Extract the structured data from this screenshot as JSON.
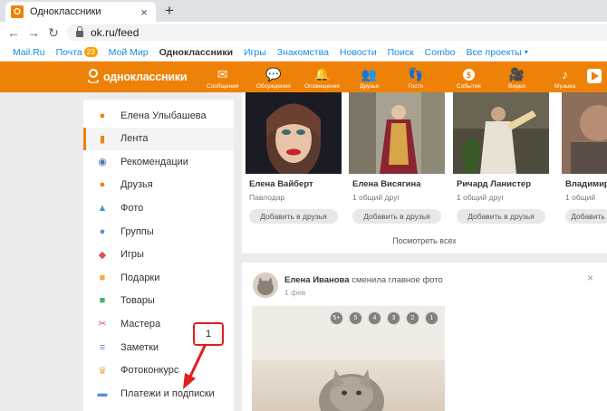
{
  "browser": {
    "tab_title": "Одноклассники",
    "tab_favicon": "О",
    "tab_close": "×",
    "new_tab": "+",
    "back": "←",
    "forward": "→",
    "reload": "↻",
    "url": "ok.ru/feed"
  },
  "portal_bar": {
    "items": [
      {
        "label": "Mail.Ru"
      },
      {
        "label": "Почта",
        "badge": "23"
      },
      {
        "label": "Мой Мир"
      },
      {
        "label": "Одноклассники",
        "active": true
      },
      {
        "label": "Игры"
      },
      {
        "label": "Знакомства"
      },
      {
        "label": "Новости"
      },
      {
        "label": "Поиск"
      },
      {
        "label": "Combo"
      },
      {
        "label": "Все проекты",
        "caret": "▾"
      }
    ]
  },
  "header": {
    "logo_text": "одноклассники",
    "brand_color": "#ee8208",
    "nav": [
      {
        "label": "Сообщения",
        "icon": "envelope-icon",
        "glyph": "✉"
      },
      {
        "label": "Обсуждения",
        "icon": "chat-icon",
        "glyph": "💬"
      },
      {
        "label": "Оповещения",
        "icon": "bell-icon",
        "glyph": "🔔"
      },
      {
        "label": "Друзья",
        "icon": "friends-icon",
        "glyph": "👥"
      },
      {
        "label": "Гости",
        "icon": "footprints-icon",
        "glyph": "👣"
      },
      {
        "label": "События",
        "icon": "coin-icon",
        "glyph": "$"
      },
      {
        "label": "Видео",
        "icon": "video-camera-icon",
        "glyph": "🎥"
      },
      {
        "label": "Музыка",
        "icon": "music-note-icon",
        "glyph": "♪"
      }
    ]
  },
  "left_menu": {
    "items": [
      {
        "label": "Елена Улыбашева",
        "icon": "profile-icon",
        "color": "#ee8208",
        "glyph": "●"
      },
      {
        "label": "Лента",
        "icon": "feed-icon",
        "color": "#ee8208",
        "glyph": "▮",
        "active": true
      },
      {
        "label": "Рекомендации",
        "icon": "compass-icon",
        "color": "#4a76a8",
        "glyph": "◉"
      },
      {
        "label": "Друзья",
        "icon": "friends-icon",
        "color": "#ee8208",
        "glyph": "●"
      },
      {
        "label": "Фото",
        "icon": "photo-icon",
        "color": "#3f9ad8",
        "glyph": "▲"
      },
      {
        "label": "Группы",
        "icon": "groups-icon",
        "color": "#5a8dd6",
        "glyph": "●"
      },
      {
        "label": "Игры",
        "icon": "gamepad-icon",
        "color": "#d9534f",
        "glyph": "◆"
      },
      {
        "label": "Подарки",
        "icon": "gift-icon",
        "color": "#f0ad4e",
        "glyph": "■"
      },
      {
        "label": "Товары",
        "icon": "shopping-bag-icon",
        "color": "#3fb56b",
        "glyph": "■"
      },
      {
        "label": "Мастера",
        "icon": "tools-icon",
        "color": "#d9534f",
        "glyph": "✂"
      },
      {
        "label": "Заметки",
        "icon": "notes-icon",
        "color": "#5a8dd6",
        "glyph": "≡"
      },
      {
        "label": "Фотоконкурс",
        "icon": "trophy-icon",
        "color": "#f0ad4e",
        "glyph": "♛"
      },
      {
        "label": "Платежи и подписки",
        "icon": "wallet-icon",
        "color": "#5a8dd6",
        "glyph": "▬"
      }
    ]
  },
  "suggestions": {
    "people": [
      {
        "name": "Елена Вайберт",
        "sub": "Павлодар",
        "button": "Добавить в друзья"
      },
      {
        "name": "Елена Висягина",
        "sub": "1 общий друг",
        "button": "Добавить в друзья"
      },
      {
        "name": "Ричард Ланистер",
        "sub": "1 общий друг",
        "button": "Добавить в друзья"
      },
      {
        "name": "Владимир",
        "sub": "1 общий",
        "button": "Добавить"
      }
    ],
    "see_all": "Посмотреть всех"
  },
  "post": {
    "author": "Елена Иванова",
    "action": "сменила главное фото",
    "date": "1 фев",
    "close": "×",
    "ratings": [
      "5+",
      "5",
      "4",
      "3",
      "2",
      "1"
    ]
  },
  "annotation": {
    "number": "1",
    "color": "#e11d1d"
  }
}
